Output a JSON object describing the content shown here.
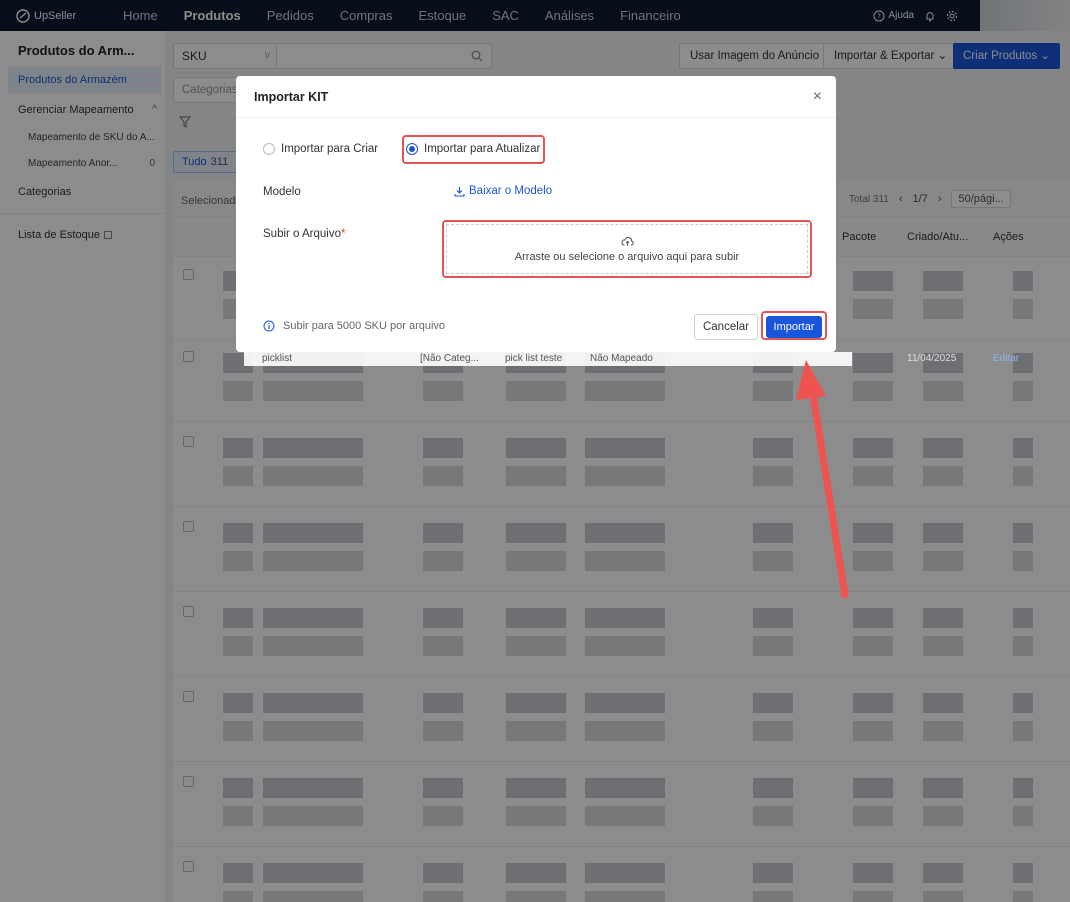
{
  "topbar": {
    "brand": "UpSeller",
    "nav": [
      "Home",
      "Produtos",
      "Pedidos",
      "Compras",
      "Estoque",
      "SAC",
      "Análises",
      "Financeiro"
    ],
    "active_nav": "Produtos",
    "help_label": "Ajuda"
  },
  "sidebar": {
    "title": "Produtos do Arm...",
    "items": [
      {
        "label": "Produtos do Armazém",
        "active": true
      },
      {
        "label": "Gerenciar Mapeamento"
      },
      {
        "label": "Mapeamento de SKU do A..."
      },
      {
        "label": "Mapeamento Anor...",
        "count": "0"
      },
      {
        "label": "Categorias"
      },
      {
        "label": "Lista de Estoque"
      }
    ]
  },
  "main": {
    "sku_select": "SKU",
    "category_placeholder": "Categorias",
    "btn_use_image": "Usar Imagem do Anúncio",
    "btn_import_export": "Importar & Exportar",
    "btn_create": "Criar Produtos",
    "tab_all_label": "Tudo",
    "tab_all_count": "311",
    "selected_label": "Selecionado",
    "total_label": "Total 311",
    "page_indicator": "1/7",
    "per_page": "50/pági...",
    "col_package": "Pacote",
    "col_created": "Criado/Atu...",
    "col_actions": "Ações",
    "peek_row": {
      "name": "picklist",
      "category": "[Não Categ...",
      "sku": "pick list teste",
      "mapping": "Não Mapeado",
      "date": "11/04/2025",
      "action": "Editar"
    }
  },
  "modal": {
    "title": "Importar KIT",
    "close": "×",
    "option_create": "Importar para Criar",
    "option_update": "Importar para Atualizar",
    "selected_option": "Importar para Atualizar",
    "model_label": "Modelo",
    "download_link": "Baixar o Modelo",
    "upload_label": "Subir o Arquivo",
    "required_mark": "*",
    "upload_text": "Arraste ou selecione o arquivo aqui para subir",
    "info_text": "Subir para 5000 SKU por arquivo",
    "btn_cancel": "Cancelar",
    "btn_import": "Importar"
  },
  "colors": {
    "primary": "#1a56db",
    "highlight": "#e05656",
    "nav_bg": "#0c1a2e"
  }
}
